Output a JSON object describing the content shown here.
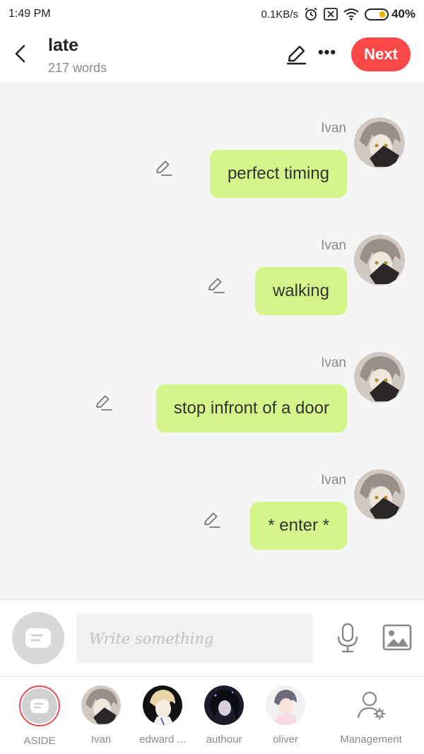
{
  "status_bar": {
    "time": "1:49 PM",
    "net_speed": "0.1KB/s",
    "battery_percent": "40%",
    "battery_level": 0.4,
    "icons": [
      "alarm-icon",
      "screen-cast-icon",
      "wifi-icon",
      "battery-icon"
    ]
  },
  "header": {
    "title": "late",
    "word_count": "217 words",
    "next_label": "Next",
    "icons": [
      "back-arrow-icon",
      "pencil-icon",
      "more-icon"
    ]
  },
  "messages": [
    {
      "sender": "Ivan",
      "text": "perfect timing"
    },
    {
      "sender": "Ivan",
      "text": "walking"
    },
    {
      "sender": "Ivan",
      "text": "stop infront of a door"
    },
    {
      "sender": "Ivan",
      "text": "* enter *"
    }
  ],
  "input": {
    "placeholder": "Write something",
    "icons": [
      "aside-bubble-icon",
      "microphone-icon",
      "image-icon"
    ]
  },
  "characters": [
    {
      "label": "ASIDE"
    },
    {
      "label": "Ivan"
    },
    {
      "label": "edward ..."
    },
    {
      "label": "authour"
    },
    {
      "label": "oliver"
    },
    {
      "label": "Management"
    }
  ],
  "colors": {
    "accent": "#fa4747",
    "bubble": "#d4f589",
    "muted_text": "#8a8a8a"
  }
}
